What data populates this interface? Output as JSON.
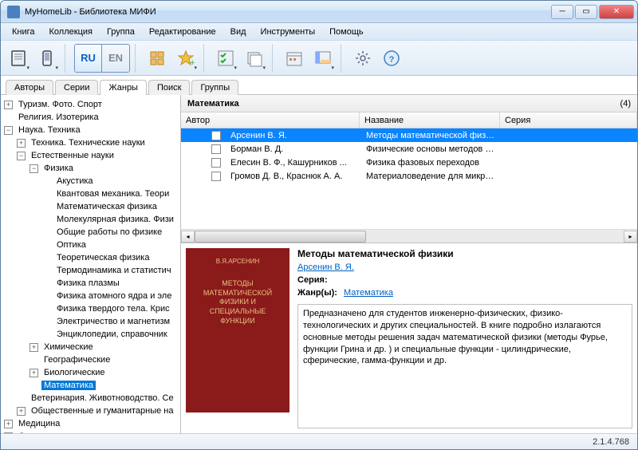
{
  "title": "MyHomeLib - Библиотека МИФИ",
  "menu": [
    "Книга",
    "Коллекция",
    "Группа",
    "Редактирование",
    "Вид",
    "Инструменты",
    "Помощь"
  ],
  "lang": {
    "ru": "RU",
    "en": "EN"
  },
  "tabs": [
    "Авторы",
    "Серии",
    "Жанры",
    "Поиск",
    "Группы"
  ],
  "active_tab": 2,
  "tree": {
    "l0a": "Туризм. Фото. Спорт",
    "l0b": "Религия. Изотерика",
    "l0c": "Наука. Техника",
    "l1a": "Техника. Технические науки",
    "l1b": "Естественные науки",
    "l2a": "Физика",
    "l3": [
      "Акустика",
      "Квантовая механика. Теори",
      "Математическая физика",
      "Молекулярная физика. Физи",
      "Общие работы по физике",
      "Оптика",
      "Теоретическая физика",
      "Термодинамика и статистич",
      "Физика плазмы",
      "Физика атомного ядра и эле",
      "Физика твердого тела. Крис",
      "Электричество и магнетизм",
      "Энциклопедии, справочник"
    ],
    "l2b": "Химические",
    "l2c": "Географические",
    "l2d": "Биологические",
    "l2e": "Математика",
    "l1c": "Ветеринария. Животноводство. Се",
    "l1d": "Общественные и гуманитарные на",
    "l0d": "Медицина",
    "l0e": "Справочная литература"
  },
  "category": {
    "name": "Математика",
    "count": "(4)"
  },
  "columns": {
    "author": "Автор",
    "title": "Название",
    "series": "Серия"
  },
  "rows": [
    {
      "author": "Арсенин В. Я.",
      "title": "Методы математической физики",
      "sel": true
    },
    {
      "author": "Борман В. Д.",
      "title": "Физические основы методов иссл...",
      "sel": false
    },
    {
      "author": "Елесин В. Ф., Кашурников ...",
      "title": "Физика фазовых переходов",
      "sel": false
    },
    {
      "author": "Громов Д. В., Краснюк А. А.",
      "title": "Материаловедение для микро- и н...",
      "sel": false
    }
  ],
  "detail": {
    "cover_author": "В.Я.АРСЕНИН",
    "cover_title": "МЕТОДЫ МАТЕМАТИЧЕСКОЙ ФИЗИКИ И СПЕЦИАЛЬНЫЕ ФУНКЦИИ",
    "book_title": "Методы математической физики",
    "author_link": "Арсенин В. Я.",
    "series_label": "Серия:",
    "genre_label": "Жанр(ы):",
    "genre_link": "Математика",
    "description": "Предназначено для студентов инженерно-физических, физико- технологических и других специальностей. В книге подробно излагаются основные методы решения задач математической физики (методы Фурье, функции Грина и др. ) и специальные функции - цилиндрические, сферические, гамма-функции и др."
  },
  "version": "2.1.4.768"
}
